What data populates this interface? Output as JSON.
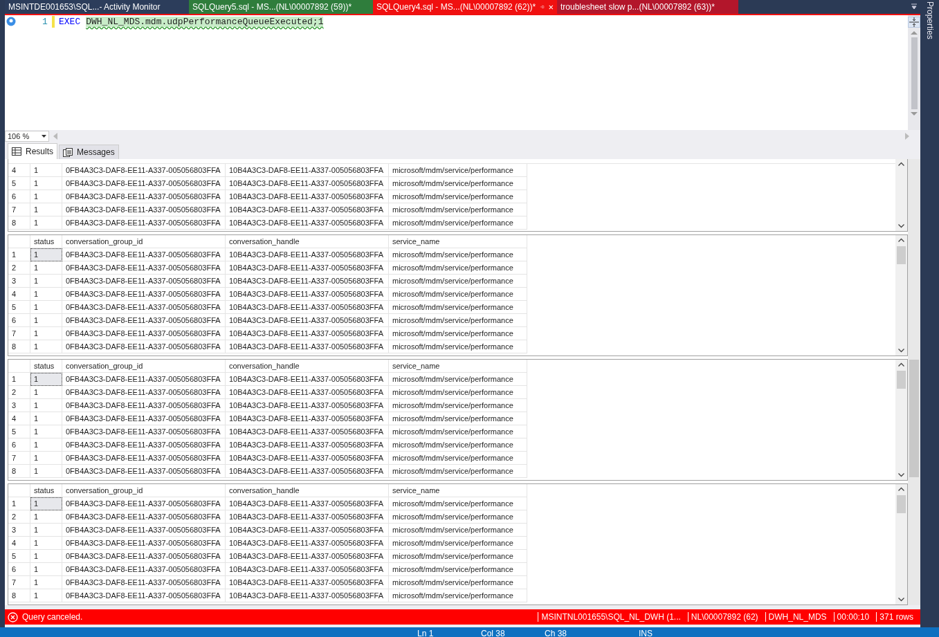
{
  "document_tabs": [
    {
      "label": "MSINTDE001653\\SQL...- Activity Monitor",
      "selected": false,
      "color": "#2c3d5b"
    },
    {
      "label": "SQLQuery5.sql - MS...(NL\\00007892 (59))*",
      "selected": false,
      "color": "#2f7d3c"
    },
    {
      "label": "SQLQuery4.sql - MS...(NL\\00007892 (62))*",
      "selected": true,
      "color": "#f01010"
    },
    {
      "label": "troublesheet slow p...(NL\\00007892 (63))*",
      "selected": false,
      "color": "#b3162b"
    }
  ],
  "editor": {
    "line_number": "1",
    "keyword": "EXEC",
    "statement": "DWH_NL_MDS.mdm.udpPerformanceQueueExecuted;1"
  },
  "zoom": "106 %",
  "result_tabs": [
    {
      "label": "Results",
      "selected": true
    },
    {
      "label": "Messages",
      "selected": false
    }
  ],
  "grids": [
    {
      "rows": [
        {
          "row": "4",
          "selected": false,
          "cells": [
            "1",
            "0FB4A3C3-DAF8-EE11-A337-005056803FFA",
            "10B4A3C3-DAF8-EE11-A337-005056803FFA",
            "microsoft/mdm/service/performance"
          ]
        },
        {
          "row": "5",
          "selected": false,
          "cells": [
            "1",
            "0FB4A3C3-DAF8-EE11-A337-005056803FFA",
            "10B4A3C3-DAF8-EE11-A337-005056803FFA",
            "microsoft/mdm/service/performance"
          ]
        },
        {
          "row": "6",
          "selected": false,
          "cells": [
            "1",
            "0FB4A3C3-DAF8-EE11-A337-005056803FFA",
            "10B4A3C3-DAF8-EE11-A337-005056803FFA",
            "microsoft/mdm/service/performance"
          ]
        },
        {
          "row": "7",
          "selected": false,
          "cells": [
            "1",
            "0FB4A3C3-DAF8-EE11-A337-005056803FFA",
            "10B4A3C3-DAF8-EE11-A337-005056803FFA",
            "microsoft/mdm/service/performance"
          ]
        },
        {
          "row": "8",
          "selected": false,
          "cells": [
            "1",
            "0FB4A3C3-DAF8-EE11-A337-005056803FFA",
            "10B4A3C3-DAF8-EE11-A337-005056803FFA",
            "microsoft/mdm/service/performance"
          ]
        }
      ]
    },
    {
      "columns": [
        "status",
        "conversation_group_id",
        "conversation_handle",
        "service_name"
      ],
      "rows": [
        {
          "row": "1",
          "selected": true,
          "cells": [
            "1",
            "0FB4A3C3-DAF8-EE11-A337-005056803FFA",
            "10B4A3C3-DAF8-EE11-A337-005056803FFA",
            "microsoft/mdm/service/performance"
          ]
        },
        {
          "row": "2",
          "selected": false,
          "cells": [
            "1",
            "0FB4A3C3-DAF8-EE11-A337-005056803FFA",
            "10B4A3C3-DAF8-EE11-A337-005056803FFA",
            "microsoft/mdm/service/performance"
          ]
        },
        {
          "row": "3",
          "selected": false,
          "cells": [
            "1",
            "0FB4A3C3-DAF8-EE11-A337-005056803FFA",
            "10B4A3C3-DAF8-EE11-A337-005056803FFA",
            "microsoft/mdm/service/performance"
          ]
        },
        {
          "row": "4",
          "selected": false,
          "cells": [
            "1",
            "0FB4A3C3-DAF8-EE11-A337-005056803FFA",
            "10B4A3C3-DAF8-EE11-A337-005056803FFA",
            "microsoft/mdm/service/performance"
          ]
        },
        {
          "row": "5",
          "selected": false,
          "cells": [
            "1",
            "0FB4A3C3-DAF8-EE11-A337-005056803FFA",
            "10B4A3C3-DAF8-EE11-A337-005056803FFA",
            "microsoft/mdm/service/performance"
          ]
        },
        {
          "row": "6",
          "selected": false,
          "cells": [
            "1",
            "0FB4A3C3-DAF8-EE11-A337-005056803FFA",
            "10B4A3C3-DAF8-EE11-A337-005056803FFA",
            "microsoft/mdm/service/performance"
          ]
        },
        {
          "row": "7",
          "selected": false,
          "cells": [
            "1",
            "0FB4A3C3-DAF8-EE11-A337-005056803FFA",
            "10B4A3C3-DAF8-EE11-A337-005056803FFA",
            "microsoft/mdm/service/performance"
          ]
        },
        {
          "row": "8",
          "selected": false,
          "cells": [
            "1",
            "0FB4A3C3-DAF8-EE11-A337-005056803FFA",
            "10B4A3C3-DAF8-EE11-A337-005056803FFA",
            "microsoft/mdm/service/performance"
          ]
        }
      ]
    },
    {
      "columns": [
        "status",
        "conversation_group_id",
        "conversation_handle",
        "service_name"
      ],
      "rows": [
        {
          "row": "1",
          "selected": true,
          "cells": [
            "1",
            "0FB4A3C3-DAF8-EE11-A337-005056803FFA",
            "10B4A3C3-DAF8-EE11-A337-005056803FFA",
            "microsoft/mdm/service/performance"
          ]
        },
        {
          "row": "2",
          "selected": false,
          "cells": [
            "1",
            "0FB4A3C3-DAF8-EE11-A337-005056803FFA",
            "10B4A3C3-DAF8-EE11-A337-005056803FFA",
            "microsoft/mdm/service/performance"
          ]
        },
        {
          "row": "3",
          "selected": false,
          "cells": [
            "1",
            "0FB4A3C3-DAF8-EE11-A337-005056803FFA",
            "10B4A3C3-DAF8-EE11-A337-005056803FFA",
            "microsoft/mdm/service/performance"
          ]
        },
        {
          "row": "4",
          "selected": false,
          "cells": [
            "1",
            "0FB4A3C3-DAF8-EE11-A337-005056803FFA",
            "10B4A3C3-DAF8-EE11-A337-005056803FFA",
            "microsoft/mdm/service/performance"
          ]
        },
        {
          "row": "5",
          "selected": false,
          "cells": [
            "1",
            "0FB4A3C3-DAF8-EE11-A337-005056803FFA",
            "10B4A3C3-DAF8-EE11-A337-005056803FFA",
            "microsoft/mdm/service/performance"
          ]
        },
        {
          "row": "6",
          "selected": false,
          "cells": [
            "1",
            "0FB4A3C3-DAF8-EE11-A337-005056803FFA",
            "10B4A3C3-DAF8-EE11-A337-005056803FFA",
            "microsoft/mdm/service/performance"
          ]
        },
        {
          "row": "7",
          "selected": false,
          "cells": [
            "1",
            "0FB4A3C3-DAF8-EE11-A337-005056803FFA",
            "10B4A3C3-DAF8-EE11-A337-005056803FFA",
            "microsoft/mdm/service/performance"
          ]
        },
        {
          "row": "8",
          "selected": false,
          "cells": [
            "1",
            "0FB4A3C3-DAF8-EE11-A337-005056803FFA",
            "10B4A3C3-DAF8-EE11-A337-005056803FFA",
            "microsoft/mdm/service/performance"
          ]
        }
      ]
    },
    {
      "columns": [
        "status",
        "conversation_group_id",
        "conversation_handle",
        "service_name"
      ],
      "rows": [
        {
          "row": "1",
          "selected": true,
          "cells": [
            "1",
            "0FB4A3C3-DAF8-EE11-A337-005056803FFA",
            "10B4A3C3-DAF8-EE11-A337-005056803FFA",
            "microsoft/mdm/service/performance"
          ]
        },
        {
          "row": "2",
          "selected": false,
          "cells": [
            "1",
            "0FB4A3C3-DAF8-EE11-A337-005056803FFA",
            "10B4A3C3-DAF8-EE11-A337-005056803FFA",
            "microsoft/mdm/service/performance"
          ]
        },
        {
          "row": "3",
          "selected": false,
          "cells": [
            "1",
            "0FB4A3C3-DAF8-EE11-A337-005056803FFA",
            "10B4A3C3-DAF8-EE11-A337-005056803FFA",
            "microsoft/mdm/service/performance"
          ]
        },
        {
          "row": "4",
          "selected": false,
          "cells": [
            "1",
            "0FB4A3C3-DAF8-EE11-A337-005056803FFA",
            "10B4A3C3-DAF8-EE11-A337-005056803FFA",
            "microsoft/mdm/service/performance"
          ]
        },
        {
          "row": "5",
          "selected": false,
          "cells": [
            "1",
            "0FB4A3C3-DAF8-EE11-A337-005056803FFA",
            "10B4A3C3-DAF8-EE11-A337-005056803FFA",
            "microsoft/mdm/service/performance"
          ]
        },
        {
          "row": "6",
          "selected": false,
          "cells": [
            "1",
            "0FB4A3C3-DAF8-EE11-A337-005056803FFA",
            "10B4A3C3-DAF8-EE11-A337-005056803FFA",
            "microsoft/mdm/service/performance"
          ]
        },
        {
          "row": "7",
          "selected": false,
          "cells": [
            "1",
            "0FB4A3C3-DAF8-EE11-A337-005056803FFA",
            "10B4A3C3-DAF8-EE11-A337-005056803FFA",
            "microsoft/mdm/service/performance"
          ]
        },
        {
          "row": "8",
          "selected": false,
          "cells": [
            "1",
            "0FB4A3C3-DAF8-EE11-A337-005056803FFA",
            "10B4A3C3-DAF8-EE11-A337-005056803FFA",
            "microsoft/mdm/service/performance"
          ]
        }
      ]
    }
  ],
  "query_status": {
    "message": "Query canceled.",
    "segments": [
      "MSINTNL001655\\SQL_NL_DWH (1...",
      "NL\\00007892 (62)",
      "DWH_NL_MDS",
      "00:00:10",
      "371 rows"
    ]
  },
  "bottom_status": [
    "Ln 1",
    "Col 38",
    "Ch 38",
    "INS"
  ],
  "side_panel": "Properties"
}
